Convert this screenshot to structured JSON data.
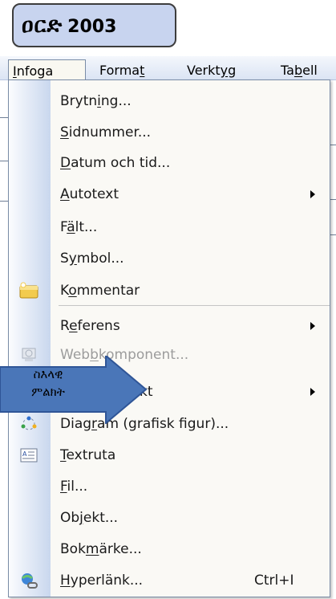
{
  "title": {
    "script": "ዐርድ",
    "version": "2003"
  },
  "menubar": {
    "items": [
      {
        "pre": "",
        "u": "I",
        "post": "nfoga"
      },
      {
        "pre": "Forma",
        "u": "t",
        "post": ""
      },
      {
        "pre": "Verkt",
        "u": "y",
        "post": "g"
      },
      {
        "pre": "Ta",
        "u": "b",
        "post": "ell"
      }
    ]
  },
  "menu": {
    "items": [
      {
        "pre": "Brytn",
        "u": "i",
        "post": "ng..."
      },
      {
        "pre": "",
        "u": "S",
        "post": "idnummer..."
      },
      {
        "pre": "",
        "u": "D",
        "post": "atum och tid..."
      },
      {
        "pre": "",
        "u": "A",
        "post": "utotext"
      },
      {
        "pre": "F",
        "u": "ä",
        "post": "lt..."
      },
      {
        "pre": "S",
        "u": "y",
        "post": "mbol..."
      },
      {
        "pre": "K",
        "u": "o",
        "post": "mmentar"
      },
      {
        "pre": "R",
        "u": "e",
        "post": "ferens"
      },
      {
        "pre": "Web",
        "u": "b",
        "post": "komponent..."
      },
      {
        "pre": "",
        "u": "",
        "post": "kt"
      },
      {
        "pre": "Diag",
        "u": "r",
        "post": "am (grafisk figur)..."
      },
      {
        "pre": "",
        "u": "T",
        "post": "extruta"
      },
      {
        "pre": "",
        "u": "F",
        "post": "il..."
      },
      {
        "pre": "Ob",
        "u": "j",
        "post": "ekt..."
      },
      {
        "pre": "Bok",
        "u": "m",
        "post": "ärke..."
      },
      {
        "pre": "",
        "u": "H",
        "post": "yperlänk..."
      }
    ],
    "hyperlink_shortcut": "Ctrl+I"
  },
  "callout": {
    "line1": "ስእላዊ",
    "line2": "ምልክት"
  },
  "colors": {
    "menubar": "#dbe4f4",
    "menu_background": "#faf9f5",
    "gutter": "#c9d7ee",
    "callout_arrow": "#4a76b8",
    "title_badge": "#c8d4ef"
  },
  "icons": [
    "comment-icon",
    "web-component-icon",
    "diagram-icon",
    "textbox-icon",
    "hyperlink-icon"
  ]
}
